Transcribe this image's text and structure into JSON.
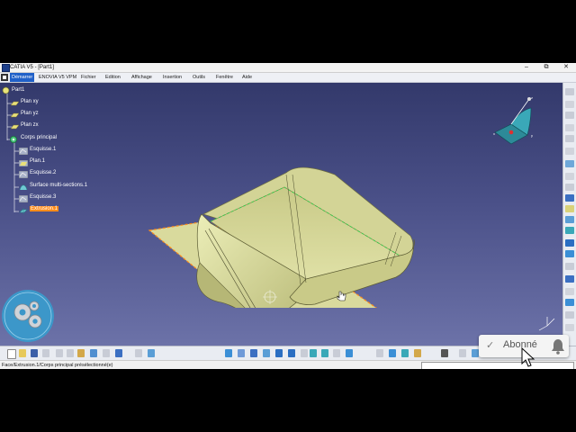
{
  "window": {
    "title": "CATIA V5 - [Part1]",
    "minimize": "–",
    "restore": "⧉",
    "close": "✕"
  },
  "menu": [
    {
      "label": "Démarrer"
    },
    {
      "label": "ENOVIA V5 VPM"
    },
    {
      "label": "Fichier"
    },
    {
      "label": "Edition"
    },
    {
      "label": "Affichage"
    },
    {
      "label": "Insertion"
    },
    {
      "label": "Outils"
    },
    {
      "label": "Fenêtre"
    },
    {
      "label": "Aide"
    }
  ],
  "tree": {
    "root": "Part1",
    "items": [
      {
        "label": "Plan xy"
      },
      {
        "label": "Plan yz"
      },
      {
        "label": "Plan zx"
      },
      {
        "label": "Corps principal"
      },
      {
        "label": "Esquisse.1"
      },
      {
        "label": "Plan.1"
      },
      {
        "label": "Esquisse.2"
      },
      {
        "label": "Surface multi-sections.1"
      },
      {
        "label": "Esquisse.3"
      },
      {
        "label": "Extrusion.1"
      }
    ]
  },
  "compass": {
    "axis_x": "x",
    "axis_y": "y",
    "axis_z": "z"
  },
  "status": {
    "message": "Face/Extrusion.1/Corps principal présélectionné(e)"
  },
  "overlay": {
    "subscribe_label": "Abonné",
    "check_icon": "✓"
  },
  "colors": {
    "viewport_top": "#33396b",
    "viewport_bottom": "#6c72a8",
    "part_fill": "#d6d79a",
    "highlight": "#ff8c1a",
    "selection": "#ff7f1f"
  }
}
